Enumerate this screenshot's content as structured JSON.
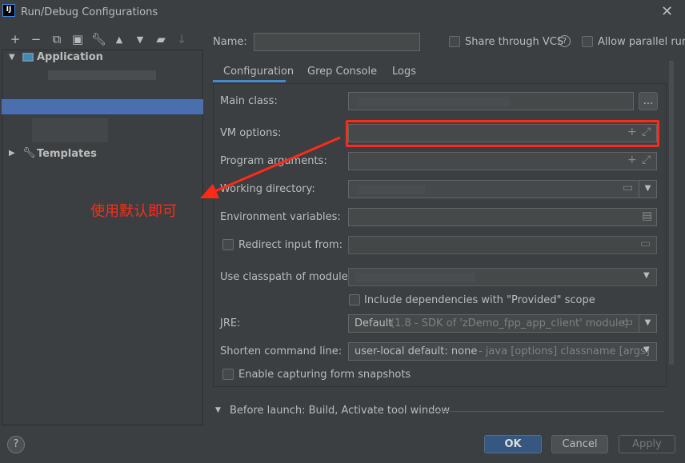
{
  "window": {
    "title": "Run/Debug Configurations",
    "logo": "IJ"
  },
  "toolbar": {
    "icons": [
      "plus-icon",
      "minus-icon",
      "copy-icon",
      "save-icon",
      "wrench-icon",
      "arrow-up-icon",
      "arrow-down-icon",
      "new-folder-icon",
      "sort-icon"
    ]
  },
  "tree": {
    "application": "Application",
    "templates": "Templates"
  },
  "name_label": "Name:",
  "share_vcs": "Share through VCS",
  "allow_parallel": "Allow parallel run",
  "tabs": [
    "Configuration",
    "Grep Console",
    "Logs"
  ],
  "form": {
    "main_class": "Main class:",
    "vm_options": "VM options:",
    "program_arguments": "Program arguments:",
    "working_directory": "Working directory:",
    "environment_variables": "Environment variables:",
    "redirect_input": "Redirect input from:",
    "classpath_module": "Use classpath of module:",
    "include_deps": "Include dependencies with \"Provided\" scope",
    "jre": "JRE:",
    "jre_value": "Default",
    "jre_hint": "(1.8 - SDK of 'zDemo_fpp_app_client' module)",
    "shorten": "Shorten command line:",
    "shorten_value": "user-local default: none",
    "shorten_hint": "- java [options] classname [args]",
    "enable_capturing": "Enable capturing form snapshots",
    "browse": "..."
  },
  "before_launch": "Before launch: Build, Activate tool window",
  "annotation": "使用默认即可",
  "annotation_color": "#ff2a1a",
  "buttons": {
    "ok": "OK",
    "cancel": "Cancel",
    "apply": "Apply",
    "help": "?"
  }
}
